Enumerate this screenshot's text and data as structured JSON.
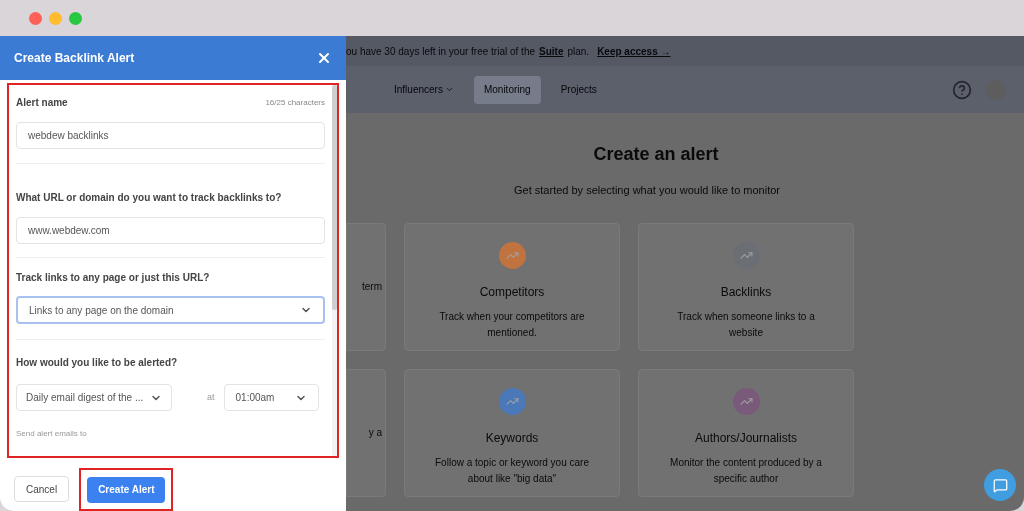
{
  "banner": {
    "text": "ou have 30 days left in your free trial of the",
    "plan_link": "Suite",
    "plan_suffix": "plan.",
    "action_link": "Keep access →"
  },
  "nav": {
    "items": [
      {
        "label": "Influencers",
        "dropdown": true,
        "selected": false
      },
      {
        "label": "Monitoring",
        "dropdown": false,
        "selected": true
      },
      {
        "label": "Projects",
        "dropdown": false,
        "selected": false
      }
    ]
  },
  "page": {
    "title": "Create an alert",
    "subtitle": "Get started by selecting what you would like to monitor",
    "cut_cards": [
      {
        "text": "term"
      },
      {
        "text": "y a"
      }
    ],
    "cards": [
      {
        "title": "Competitors",
        "description": "Track when your competitors are mentioned.",
        "color": "#c0733f"
      },
      {
        "title": "Backlinks",
        "description": "Track when someone links to a website",
        "color": "#6b6e75"
      },
      {
        "title": "Keywords",
        "description": "Follow a topic or keyword you care about like \"big data\"",
        "color": "#4a78b8"
      },
      {
        "title": "Authors/Journalists",
        "description": "Monitor the content produced by a specific author",
        "color": "#7a5a7a"
      }
    ]
  },
  "modal": {
    "title": "Create Backlink Alert",
    "alert_name": {
      "label": "Alert name",
      "counter": "16/25 characters",
      "value": "webdew backlinks"
    },
    "url": {
      "label": "What URL or domain do you want to track backlinks to?",
      "value": "www.webdew.com"
    },
    "track": {
      "label": "Track links to any page or just this URL?",
      "value": "Links to any page on the domain",
      "focused": true
    },
    "alert": {
      "label": "How would you like to be alerted?",
      "frequency": "Daily email digest of the ...",
      "at": "at",
      "time": "01:00am"
    },
    "send_label": "Send alert emails to",
    "buttons": {
      "cancel": "Cancel",
      "submit": "Create Alert"
    }
  }
}
